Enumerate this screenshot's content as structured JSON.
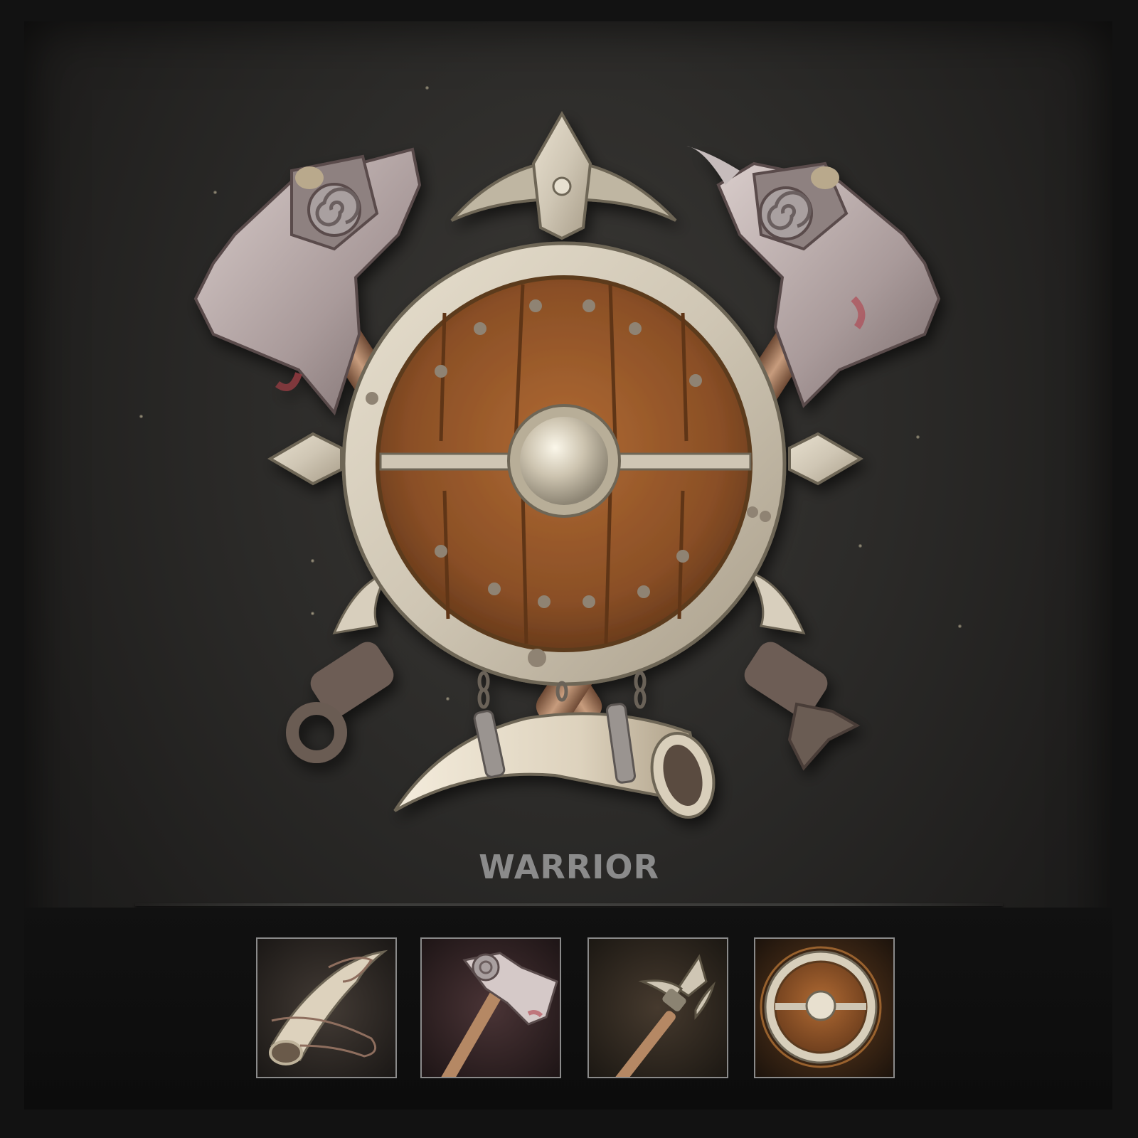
{
  "title": "WARRIOR",
  "inventory": [
    {
      "icon": "horn-icon"
    },
    {
      "icon": "axe-icon"
    },
    {
      "icon": "spear-icon"
    },
    {
      "icon": "shield-icon"
    }
  ],
  "colors": {
    "background": "#2c2b29",
    "title": "#8b8b8b",
    "wood": "#8a4f26",
    "metal": "#cfc6b4",
    "blade": "#a99a9a",
    "slot_border": "#8a8a8a"
  }
}
